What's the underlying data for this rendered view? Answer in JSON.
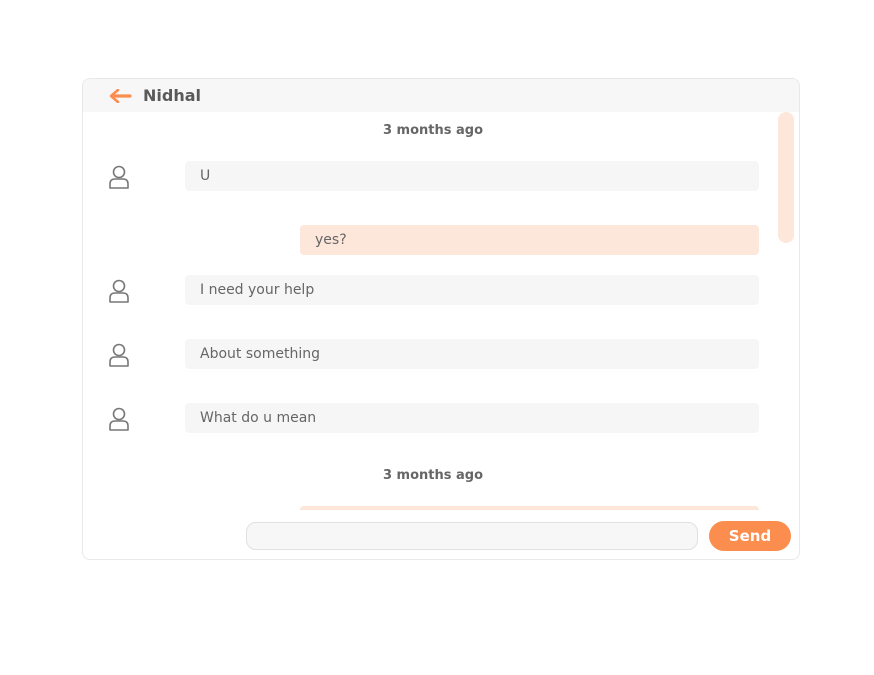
{
  "header": {
    "contact_name": "Nidhal",
    "back_icon": "arrow-left-icon"
  },
  "messages": [
    {
      "type": "timestamp",
      "text": "3 months ago"
    },
    {
      "type": "received",
      "text": "U",
      "icon": "user-icon"
    },
    {
      "type": "sent",
      "text": "yes?"
    },
    {
      "type": "received",
      "text": "I need your help",
      "icon": "user-icon"
    },
    {
      "type": "received",
      "text": "About something",
      "icon": "user-icon"
    },
    {
      "type": "received",
      "text": "What do u mean",
      "icon": "user-icon"
    },
    {
      "type": "timestamp",
      "text": "3 months ago"
    },
    {
      "type": "sent",
      "text": ""
    }
  ],
  "composer": {
    "input_value": "",
    "input_placeholder": "",
    "send_label": "Send"
  },
  "colors": {
    "accent": "#fb8d4e",
    "sent_bubble": "#fde6da",
    "received_bubble": "#f6f6f6",
    "header_bg": "#f7f7f7"
  }
}
